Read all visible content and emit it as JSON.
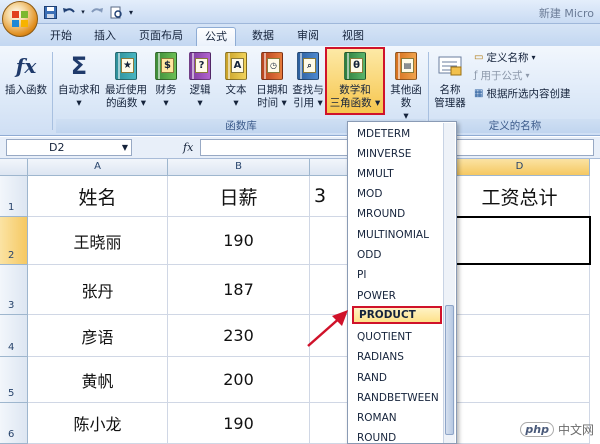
{
  "title_bar": {
    "app_title": "新建 Micro"
  },
  "tabs": [
    {
      "label": "开始"
    },
    {
      "label": "插入"
    },
    {
      "label": "页面布局"
    },
    {
      "label": "公式",
      "active": true
    },
    {
      "label": "数据"
    },
    {
      "label": "审阅"
    },
    {
      "label": "视图"
    }
  ],
  "ribbon": {
    "insert_function": "插入函数",
    "autosum": "自动求和",
    "recent_line1": "最近使用",
    "recent_line2": "的函数",
    "financial": "财务",
    "logical": "逻辑",
    "text": "文本",
    "datetime_line1": "日期和",
    "datetime_line2": "时间",
    "lookup_line1": "查找与",
    "lookup_line2": "引用",
    "math_line1": "数学和",
    "math_line2": "三角函数",
    "other_line1": "其他函数",
    "name_mgr_line1": "名称",
    "name_mgr_line2": "管理器",
    "define_name": "定义名称",
    "use_in_formula": "用于公式",
    "create_from_selection": "根据所选内容创建",
    "group_function_library": "函数库",
    "group_defined_names": "定义的名称",
    "math_glyph": "θ"
  },
  "formula_bar": {
    "name_box": "D2",
    "fx": "fx"
  },
  "columns": [
    "A",
    "B",
    "D"
  ],
  "rows": [
    "1",
    "2",
    "3",
    "4",
    "5",
    "6"
  ],
  "sheet": {
    "header_a": "姓名",
    "header_b": "日薪",
    "header_c_partial": "3",
    "header_d": "工资总计",
    "data": [
      {
        "name": "王晓丽",
        "pay": "190"
      },
      {
        "name": "张丹",
        "pay": "187"
      },
      {
        "name": "彦语",
        "pay": "230"
      },
      {
        "name": "黄帆",
        "pay": "200"
      },
      {
        "name": "陈小龙",
        "pay": "190"
      }
    ]
  },
  "dropdown": {
    "items": [
      "MDETERM",
      "MINVERSE",
      "MMULT",
      "MOD",
      "MROUND",
      "MULTINOMIAL",
      "ODD",
      "PI",
      "POWER",
      "PRODUCT",
      "QUOTIENT",
      "RADIANS",
      "RAND",
      "RANDBETWEEN",
      "ROMAN",
      "ROUND"
    ],
    "selected": "PRODUCT"
  },
  "watermark": {
    "badge": "php",
    "site": "中文网"
  },
  "colors": {
    "highlight_red": "#d0122a",
    "accent_orange": "#f6c64e"
  }
}
